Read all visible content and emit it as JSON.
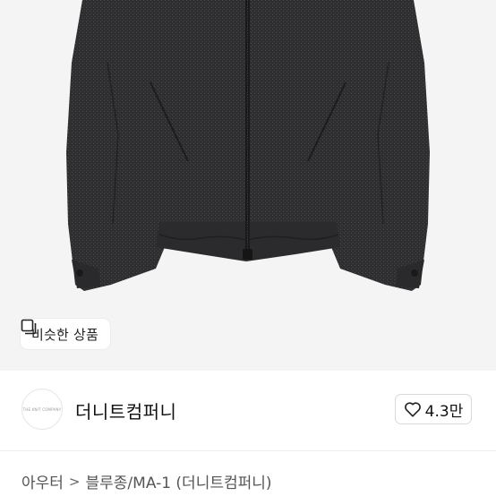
{
  "product": {
    "image_alt": "charcoal wool zip-up jacket",
    "similar_button_label": "비슷한 상품"
  },
  "shop": {
    "name": "더니트컴퍼니",
    "avatar_text": "THE KNIT COMPANY",
    "likes": "4.3만"
  },
  "breadcrumb": {
    "items": [
      "아우터",
      "블루종/MA-1 (더니트컴퍼니)"
    ],
    "separator": ">"
  },
  "colors": {
    "image_bg": "#f4f4f5",
    "jacket": "#2e2e30",
    "divider": "#ededed"
  }
}
